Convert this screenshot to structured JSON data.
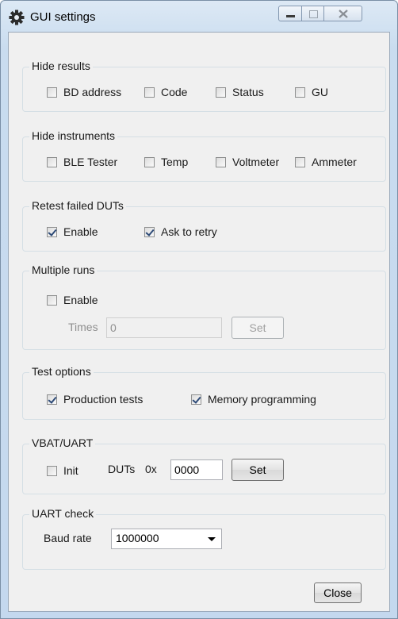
{
  "window": {
    "title": "GUI settings"
  },
  "hide_results": {
    "title": "Hide results",
    "items": [
      {
        "label": "BD address",
        "checked": false
      },
      {
        "label": "Code",
        "checked": false
      },
      {
        "label": "Status",
        "checked": false
      },
      {
        "label": "GU",
        "checked": false
      }
    ]
  },
  "hide_instruments": {
    "title": "Hide instruments",
    "items": [
      {
        "label": "BLE Tester",
        "checked": false
      },
      {
        "label": "Temp",
        "checked": false
      },
      {
        "label": "Voltmeter",
        "checked": false
      },
      {
        "label": "Ammeter",
        "checked": false
      }
    ]
  },
  "retest": {
    "title": "Retest failed DUTs",
    "enable_label": "Enable",
    "enable_checked": true,
    "ask_label": "Ask to retry",
    "ask_checked": true
  },
  "multiple_runs": {
    "title": "Multiple runs",
    "enable_label": "Enable",
    "enable_checked": false,
    "times_label": "Times",
    "times_value": "0",
    "set_label": "Set"
  },
  "test_options": {
    "title": "Test options",
    "production_label": "Production tests",
    "production_checked": true,
    "memory_label": "Memory programming",
    "memory_checked": true
  },
  "vbat_uart": {
    "title": "VBAT/UART",
    "init_label": "Init",
    "init_checked": false,
    "duts_label": "DUTs",
    "hex_prefix": "0x",
    "duts_value": "0000",
    "set_label": "Set"
  },
  "uart_check": {
    "title": "UART check",
    "baud_label": "Baud rate",
    "baud_value": "1000000"
  },
  "footer": {
    "close_label": "Close"
  },
  "icons": {
    "app": "gear-icon",
    "minimize": "minimize-icon",
    "maximize": "maximize-icon",
    "close": "close-x-icon",
    "dropdown": "chevron-down-icon",
    "check": "check-mark-icon"
  }
}
